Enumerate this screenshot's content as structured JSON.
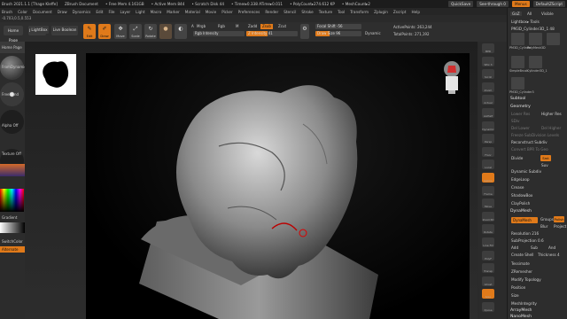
{
  "titlebar": {
    "app": "Brush 2021.1.1 [Thage Kleffe]",
    "doc": "ZBrush Document",
    "free_mem": "• Free Mem 4.161GB",
    "active_mem": "• Active Mem 844",
    "scratch": "• Scratch Disk 44",
    "timer": "• Timer▸0.338 ATime▸0.011",
    "polycount": "• PolyCount▸274.612 KP",
    "meshcount": "• MeshCount▸2",
    "quicksave": "QuickSave",
    "seethrough": "See-through  0",
    "menus": "Menus",
    "defaultscript": "DefaultZScript"
  },
  "menubar": [
    "Brush",
    "Color",
    "Document",
    "Draw",
    "Dynamics",
    "Edit",
    "File",
    "Layer",
    "Light",
    "Macro",
    "Marker",
    "Material",
    "Movie",
    "Picker",
    "Preferences",
    "Render",
    "Stencil",
    "Stroke",
    "Texture",
    "Tool",
    "Transform",
    "Zplugin",
    "Zscript",
    "Help"
  ],
  "coords": "-0.703,0.5,0.553",
  "toolbar": {
    "home_page": "Home Page",
    "lightbox": "LightBox",
    "live_boolean": "Live Boolean",
    "edit": "Edit",
    "draw": "Draw",
    "move": "Move",
    "scale": "Scale",
    "rotate": "Rotate",
    "a_label": "A",
    "mrgb": "Mrgb",
    "rgb": "Rgb",
    "m": "M",
    "zadd": "Zadd",
    "zsub": "Zsub",
    "zcut": "Zcut",
    "rgb_intensity": "Rgb Intensity",
    "z_intensity": "Z Intensity  41",
    "focal_shift": "Focal Shift -56",
    "draw_size": "Draw Size 96",
    "dynamic": "Dynamic",
    "active_points": "ActivePoints: 263,244",
    "total_points": "TotalPoints: 271,192"
  },
  "left": {
    "home": "Home Page",
    "from_dynamic": "FromDynamic",
    "freehand": "FreeHand",
    "alpha_off": "Alpha Off",
    "texture_off": "Texture Off",
    "gradient": "Gradient",
    "switch_color": "SwitchColor",
    "alternate": "Alternate"
  },
  "alpha_preview_label": "Alpha",
  "right_shelf": [
    "BPR",
    "SPix 3",
    "Scroll",
    "Zoom",
    "Actual",
    "AAHalf",
    "Dynamic",
    "Persp",
    "Floor",
    "Local",
    "Gizmo",
    "Frame",
    "Move",
    "Zoom3D",
    "Rotate",
    "Line Fill",
    "PolyF",
    "Transp",
    "Ghost",
    "Solo",
    "Xpose"
  ],
  "panel": {
    "goz": "GoZ",
    "all": "All",
    "visible": "Visible",
    "lightbox_tools": "Lightbox▸ Tools",
    "current_tool": "PM3D_Cylinder3D_1  48",
    "thumbs": [
      "PM3D_Cylinde",
      "PolyMesh3D",
      "SimpleBrush",
      "Cylinder3D_1",
      "PM3D_Cylinder3"
    ],
    "subtool": "Subtool",
    "geometry": "Geometry",
    "lower_res": "Lower Res",
    "higher_res": "Higher Res",
    "sdiv": "SDiv",
    "del_lower": "Del Lower",
    "del_higher": "Del Higher",
    "freeze_subdiv": "Freeze SubDivision Levels",
    "reconstruct_subdiv": "Reconstruct Subdiv",
    "convert_bpr": "Convert BPR To Geo",
    "divide": "Divide",
    "smt": "Smt",
    "suv": "Suv",
    "rsmt": "ReUV",
    "dynamic_subdiv": "Dynamic Subdiv",
    "edgeloop": "EdgeLoop",
    "crease": "Crease",
    "shadowbox": "ShadowBox",
    "claypolish": "ClayPolish",
    "dynamesh_hdr": "DynaMesh",
    "dynamesh_btn": "DynaMesh",
    "groups": "Groups",
    "polish": "Polish",
    "blur": "Blur",
    "project": "Project",
    "resolution": "Resolution  216",
    "subprojection": "SubProjection  0.6",
    "add": "Add",
    "sub": "Sub",
    "and": "And",
    "create_shell": "Create Shell",
    "thickness": "Thickness 4",
    "tessimate": "Tessimate",
    "zremesher": "ZRemesher",
    "modify_topology": "Modify Topology",
    "position": "Position",
    "size": "Size",
    "meshintegrity": "MeshIntegrity",
    "arraymesh": "ArrayMesh",
    "nanomesh": "NanoMesh"
  },
  "colors": {
    "accent": "#e07a1a",
    "panel_bg": "#2d2d2d",
    "viewport_bg": "#000000"
  }
}
